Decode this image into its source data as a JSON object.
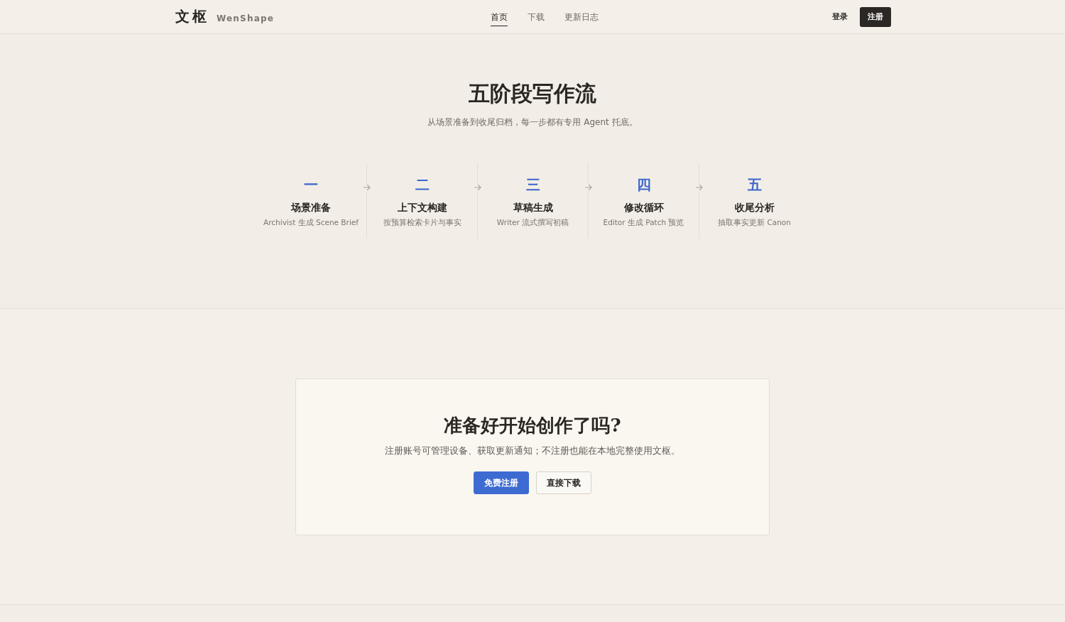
{
  "header": {
    "logo": {
      "mark": "文枢",
      "name": "WenShape"
    },
    "nav": [
      {
        "label": "首页",
        "selected": true
      },
      {
        "label": "下载",
        "selected": false
      },
      {
        "label": "更新日志",
        "selected": false
      }
    ],
    "actions": [
      {
        "label": "登录",
        "kind": "link"
      },
      {
        "label": "注册",
        "kind": "primary"
      }
    ]
  },
  "workflow": {
    "title": "五阶段写作流",
    "subtitle": "从场景准备到收尾归档，每一步都有专用 Agent 托底。",
    "steps": [
      {
        "numeral": "一",
        "title": "场景准备",
        "description": "Archivist 生成 Scene Brief"
      },
      {
        "numeral": "二",
        "title": "上下文构建",
        "description": "按预算检索卡片与事实"
      },
      {
        "numeral": "三",
        "title": "草稿生成",
        "description": "Writer 流式撰写初稿"
      },
      {
        "numeral": "四",
        "title": "修改循环",
        "description": "Editor 生成 Patch 预览"
      },
      {
        "numeral": "五",
        "title": "收尾分析",
        "description": "抽取事实更新 Canon"
      }
    ]
  },
  "cta": {
    "title": "准备好开始创作了吗?",
    "text": "注册账号可管理设备、获取更新通知；不注册也能在本地完整使用文枢。",
    "buttons": [
      {
        "label": "免费注册",
        "kind": "primary"
      },
      {
        "label": "直接下载",
        "kind": "secondary"
      }
    ]
  }
}
